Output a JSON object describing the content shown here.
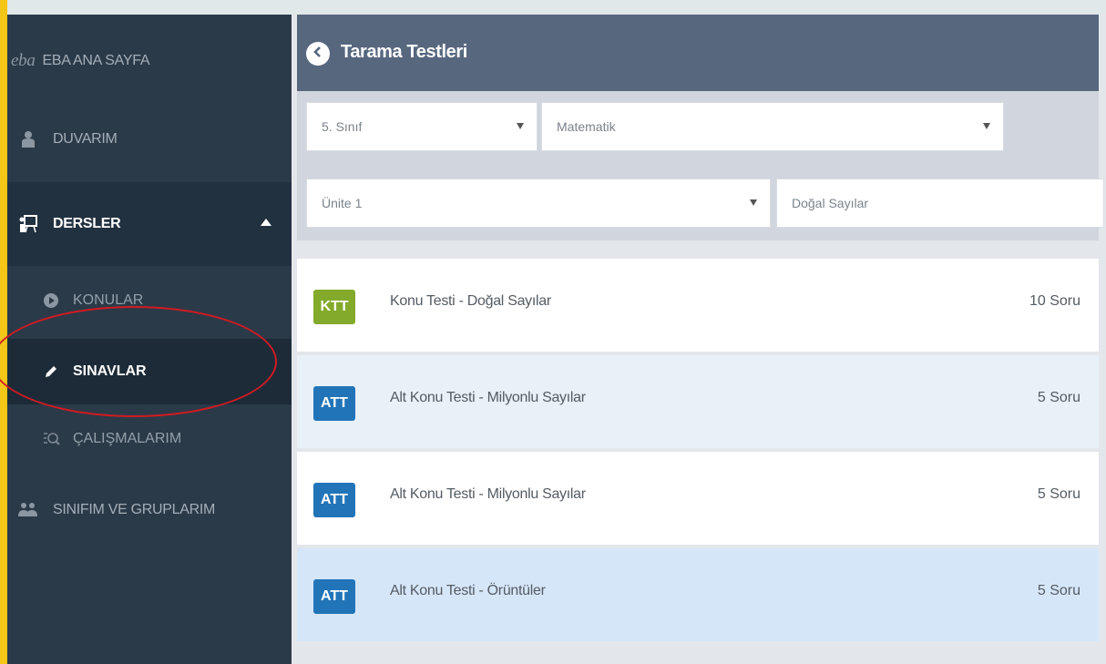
{
  "colors": {
    "sidebar_bg": "#2b3a48",
    "header_bg": "#56677e",
    "ktt_badge": "#83aa2a",
    "att_badge": "#2274b8",
    "highlight_ring": "#d11a22",
    "selected_row": "#d6e6f9"
  },
  "sidebar": {
    "items": [
      {
        "icon": "eba-logo",
        "logo_text": "eba",
        "label": "EBA ANA SAYFA"
      },
      {
        "icon": "user-icon",
        "label": "DUVARIM"
      },
      {
        "icon": "presentation-board-icon",
        "label": "DERSLER",
        "expanded": true
      },
      {
        "icon": "play-circle-icon",
        "label": "KONULAR"
      },
      {
        "icon": "pencil-icon",
        "label": "SINAVLAR",
        "active": true
      },
      {
        "icon": "search-document-icon",
        "label": "ÇALIŞMALARIM"
      },
      {
        "icon": "users-icon",
        "label": "SINIFIM VE GRUPLARIM"
      }
    ]
  },
  "header": {
    "back_icon": "chevron-left-circle-icon",
    "title": "Tarama Testleri"
  },
  "filters": {
    "grade": "5. Sınıf",
    "subject": "Matematik",
    "unit": "Ünite 1",
    "topic": "Doğal Sayılar"
  },
  "tests": [
    {
      "badge": "KTT",
      "title": "Konu Testi - Doğal Sayılar",
      "count": "10 Soru"
    },
    {
      "badge": "ATT",
      "title": "Alt Konu Testi - Milyonlu Sayılar",
      "count": "5 Soru"
    },
    {
      "badge": "ATT",
      "title": "Alt Konu Testi - Milyonlu Sayılar",
      "count": "5 Soru"
    },
    {
      "badge": "ATT",
      "title": "Alt Konu Testi - Örüntüler",
      "count": "5 Soru"
    }
  ]
}
